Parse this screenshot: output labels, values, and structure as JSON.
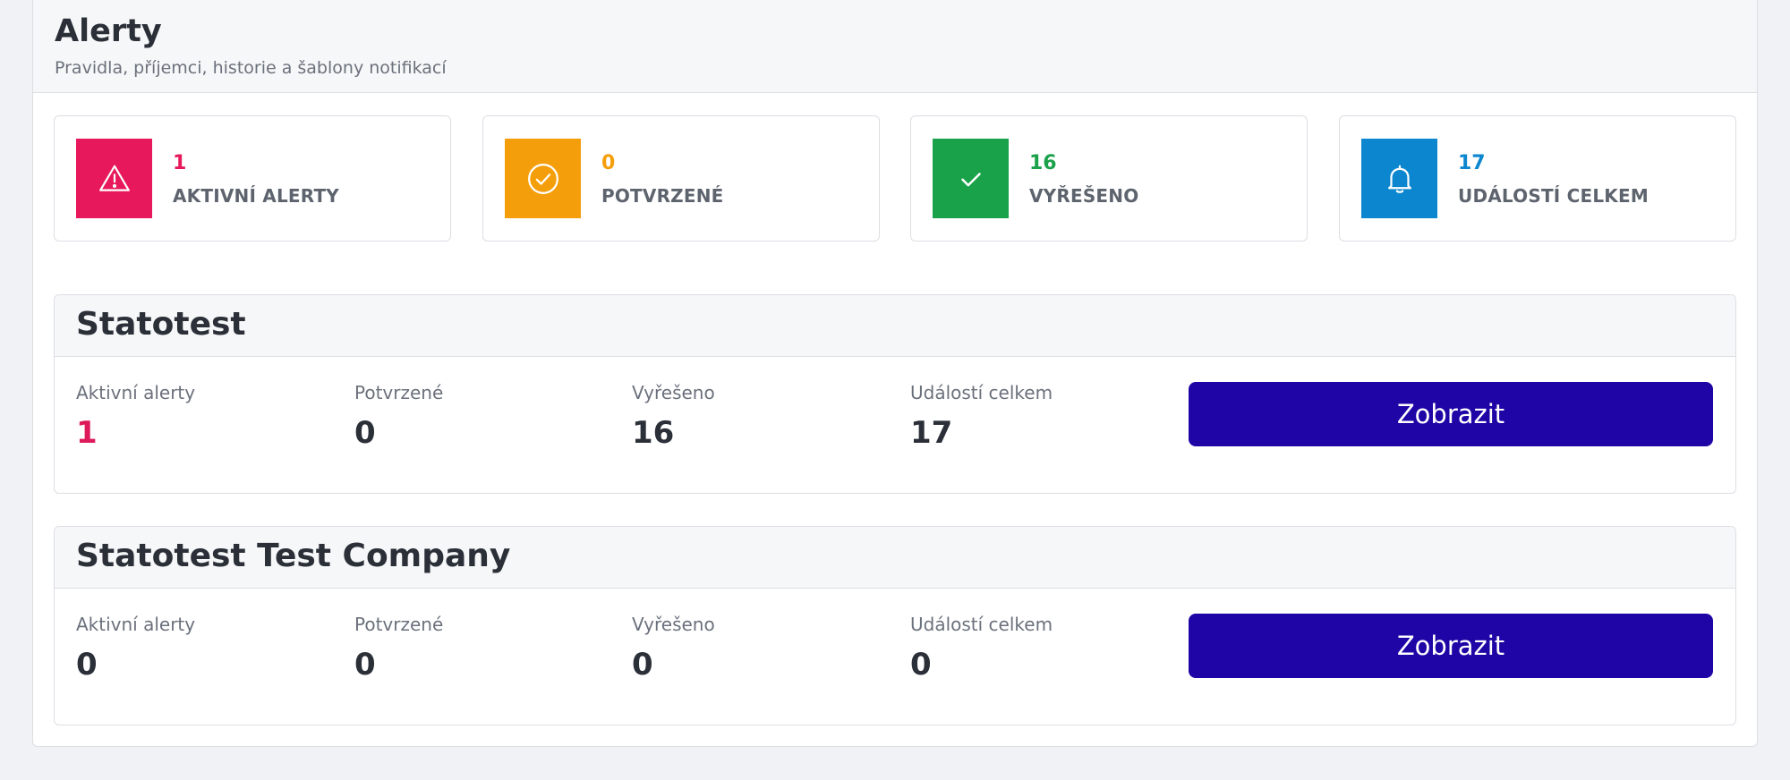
{
  "page": {
    "title": "Alerty",
    "subtitle": "Pravidla, příjemci, historie a šablony notifikací"
  },
  "summary": [
    {
      "value": "1",
      "label": "AKTIVNÍ ALERTY",
      "color": "#e8185c",
      "icon": "warning-triangle-icon"
    },
    {
      "value": "0",
      "label": "POTVRZENÉ",
      "color": "#f59e0b",
      "icon": "check-circle-icon"
    },
    {
      "value": "16",
      "label": "VYŘEŠENO",
      "color": "#1aa24a",
      "icon": "checkmark-icon"
    },
    {
      "value": "17",
      "label": "UDÁLOSTÍ CELKEM",
      "color": "#0b86cf",
      "icon": "bell-icon"
    }
  ],
  "metric_labels": {
    "active": "Aktivní alerty",
    "confirmed": "Potvrzené",
    "resolved": "Vyřešeno",
    "total": "Událostí celkem"
  },
  "companies": [
    {
      "name": "Statotest",
      "active": "1",
      "confirmed": "0",
      "resolved": "16",
      "total": "17",
      "button_label": "Zobrazit"
    },
    {
      "name": "Statotest Test Company",
      "active": "0",
      "confirmed": "0",
      "resolved": "0",
      "total": "0",
      "button_label": "Zobrazit"
    }
  ],
  "colors": {
    "accent": "#1f04a6",
    "active_alert_value": "#dd1a5a"
  }
}
